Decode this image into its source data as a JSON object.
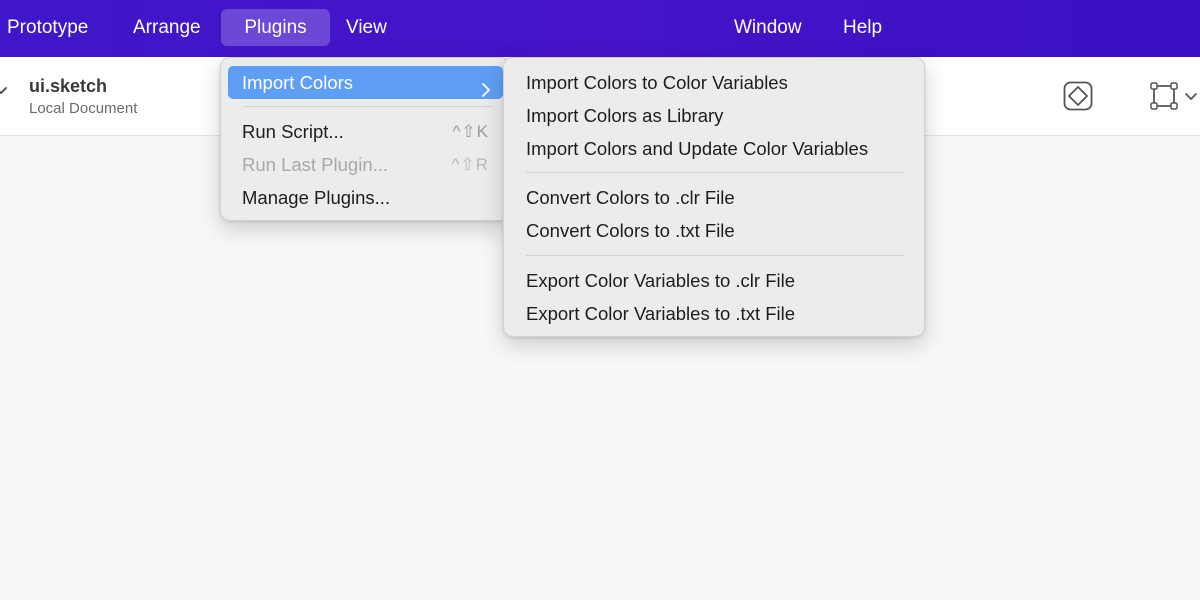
{
  "menubar": {
    "items": [
      {
        "label": "Prototype"
      },
      {
        "label": "Arrange"
      },
      {
        "label": "Plugins"
      },
      {
        "label": "View"
      },
      {
        "label": "Window"
      },
      {
        "label": "Help"
      }
    ],
    "active": "Plugins",
    "colors": {
      "gradient_start": "#3f16c9",
      "gradient_end": "#3a10c2"
    }
  },
  "document": {
    "name": "ui.sketch",
    "location": "Local Document"
  },
  "plugins_menu": {
    "items": [
      {
        "label": "Import Colors",
        "state": "highlighted",
        "submenu": true
      },
      {
        "label": "Run Script...",
        "shortcut": "^⇧K",
        "state": "enabled"
      },
      {
        "label": "Run Last Plugin...",
        "shortcut": "^⇧R",
        "state": "disabled"
      },
      {
        "label": "Manage Plugins...",
        "state": "enabled"
      }
    ]
  },
  "import_colors_submenu": {
    "groups": [
      [
        {
          "label": "Import Colors to Color Variables"
        },
        {
          "label": "Import Colors as Library"
        },
        {
          "label": "Import Colors and Update Color Variables"
        }
      ],
      [
        {
          "label": "Convert Colors to .clr File"
        },
        {
          "label": "Convert Colors to .txt File"
        }
      ],
      [
        {
          "label": "Export Color Variables to .clr File"
        },
        {
          "label": "Export Color Variables to .txt File"
        }
      ]
    ]
  },
  "toolbar": {
    "icons": [
      "symbol-icon",
      "frame-icon"
    ]
  },
  "colors": {
    "highlight": "#5e9ff5",
    "canvas": "#f8f8f8"
  }
}
